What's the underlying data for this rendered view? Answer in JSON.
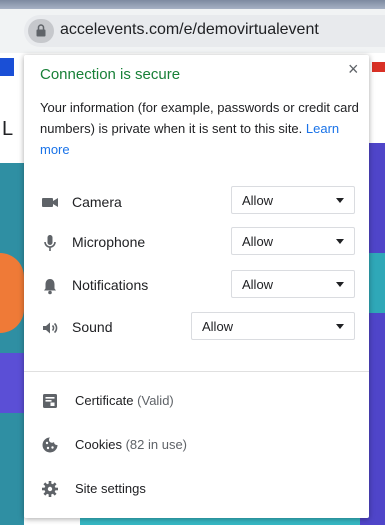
{
  "browser": {
    "url": "accelevents.com/e/demovirtualevent"
  },
  "popup": {
    "title": "Connection is secure",
    "close_label": "×",
    "description": "Your information (for example, passwords or credit card numbers) is private when it is sent to this site.",
    "learn_more": "Learn more",
    "permissions": [
      {
        "label": "Camera",
        "value": "Allow",
        "icon": "camera-icon"
      },
      {
        "label": "Microphone",
        "value": "Allow",
        "icon": "microphone-icon"
      },
      {
        "label": "Notifications",
        "value": "Allow",
        "icon": "bell-icon"
      },
      {
        "label": "Sound",
        "value": "Allow",
        "icon": "speaker-icon"
      }
    ],
    "certificate": {
      "label": "Certificate",
      "status": "(Valid)",
      "icon": "certificate-icon"
    },
    "cookies": {
      "label": "Cookies",
      "status": "(82 in use)",
      "icon": "cookie-icon"
    },
    "site_settings": {
      "label": "Site settings",
      "icon": "gear-icon"
    }
  },
  "page_fragment": {
    "letter": "L"
  },
  "colors": {
    "secure_green": "#188038",
    "link_blue": "#1a73e8"
  }
}
